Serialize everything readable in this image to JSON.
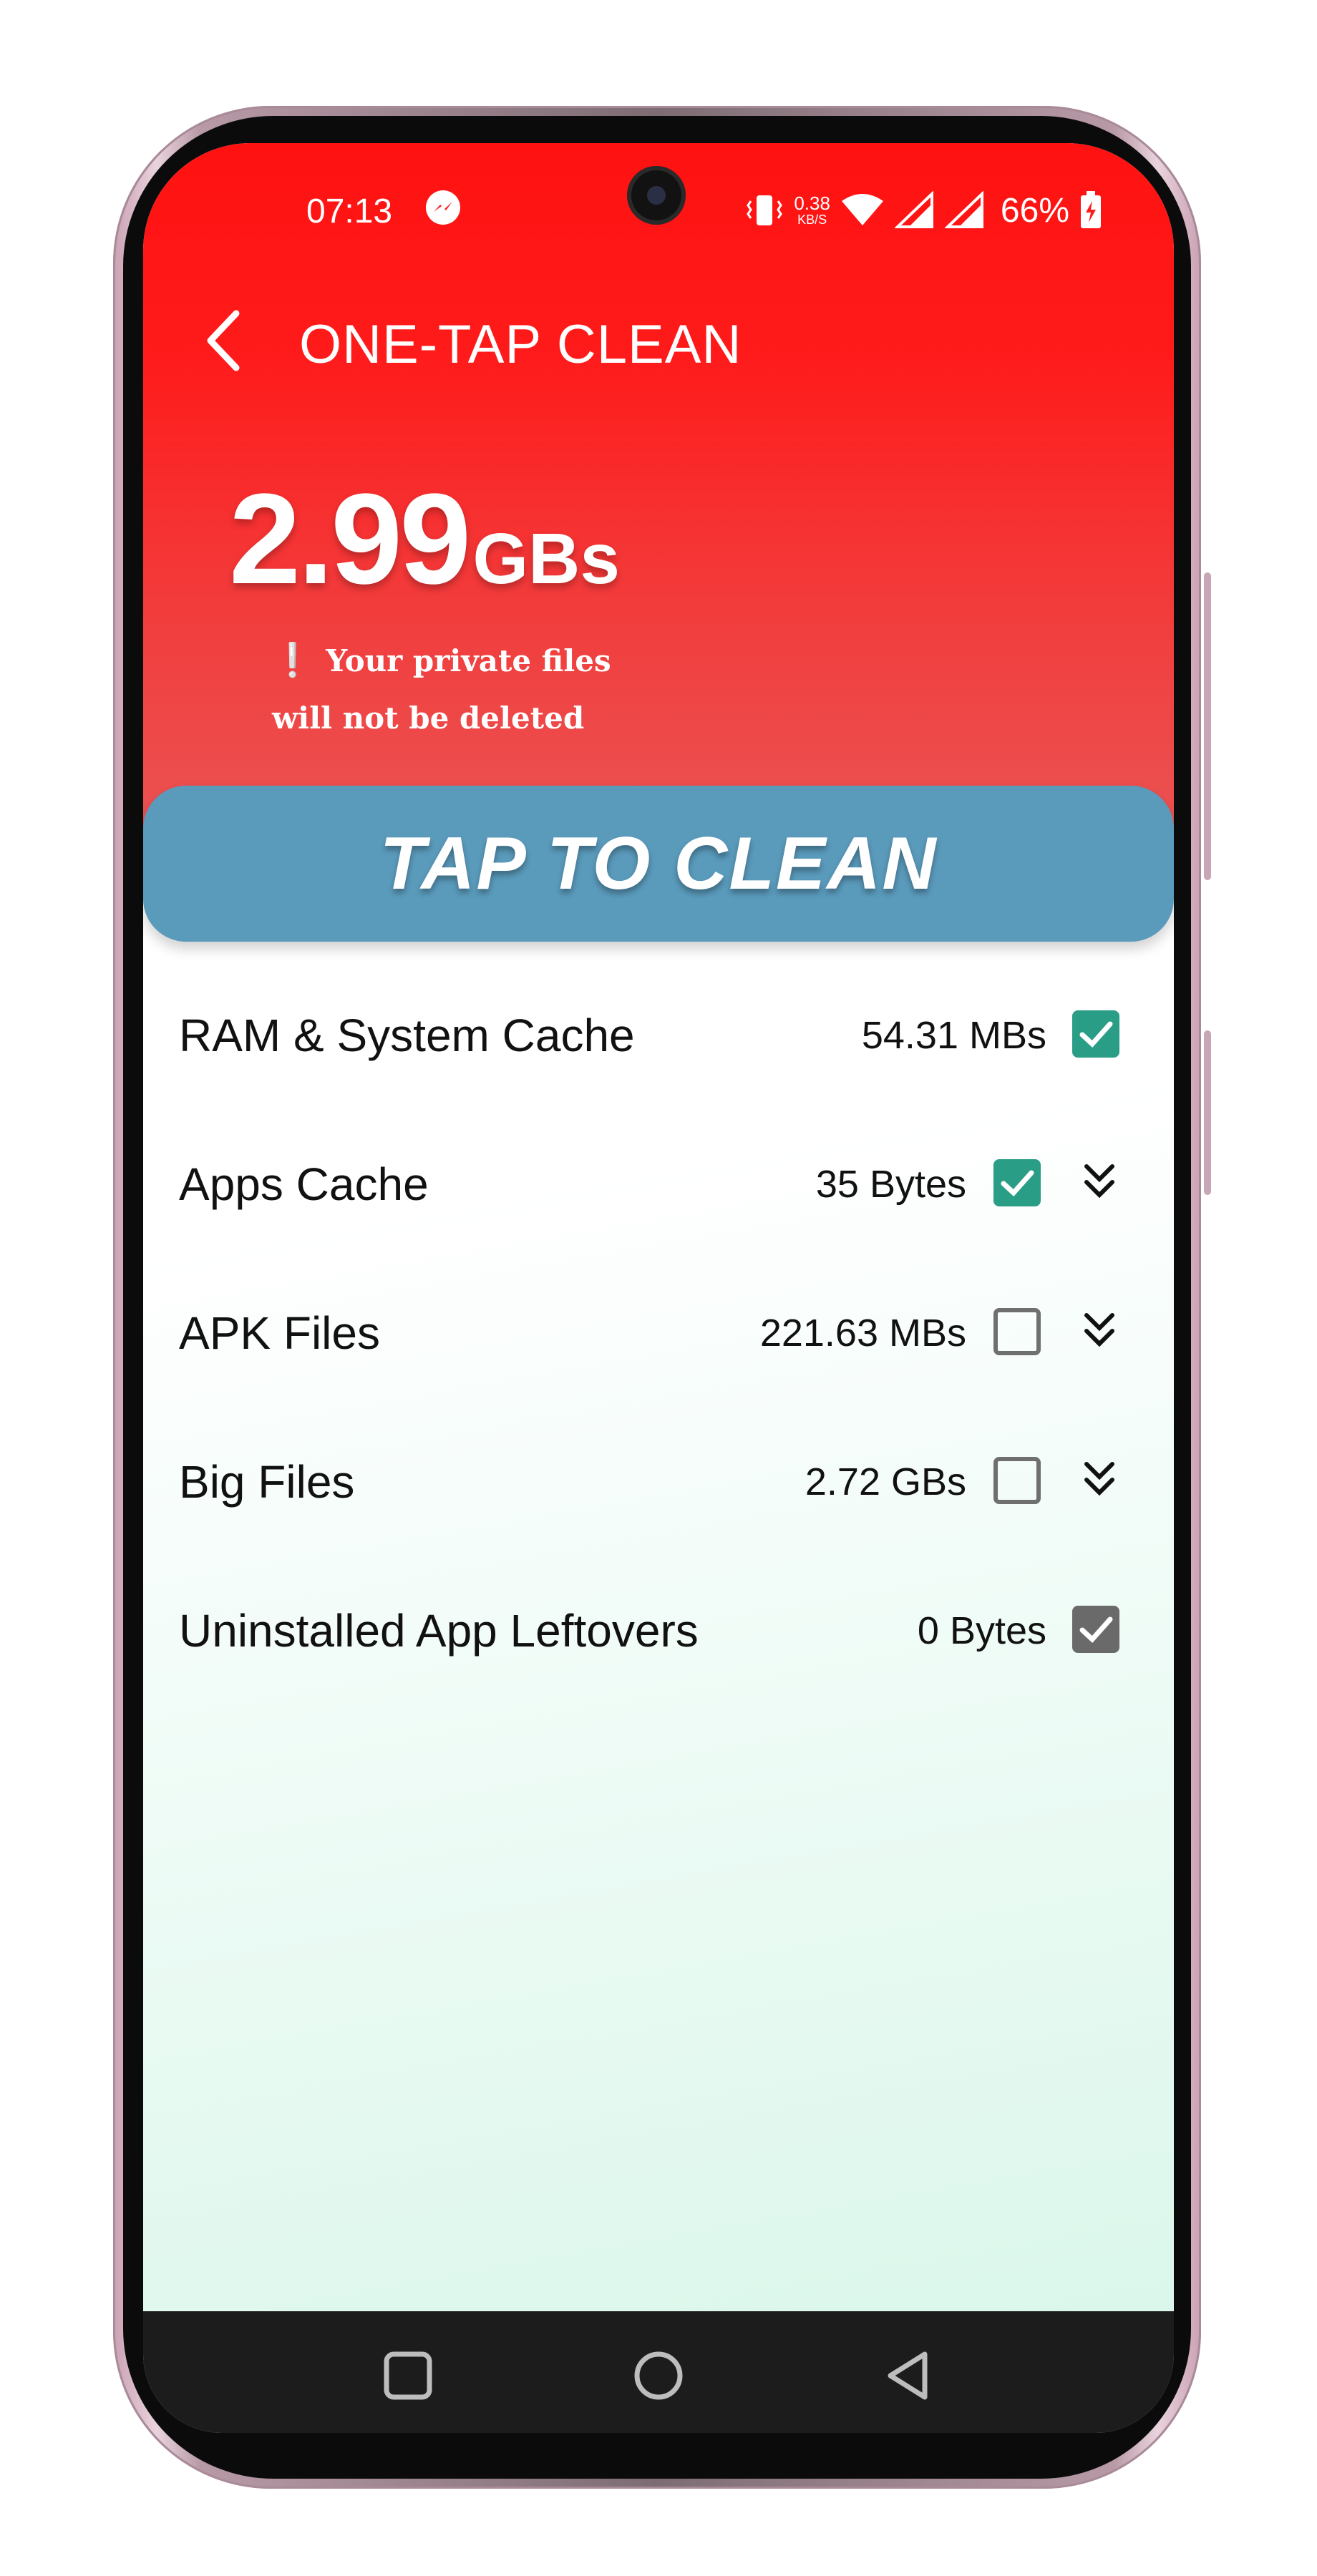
{
  "status": {
    "time": "07:13",
    "speed_value": "0.38",
    "speed_unit": "KB/S",
    "battery": "66%"
  },
  "header": {
    "title": "ONE-TAP CLEAN",
    "size_value": "2.99",
    "size_unit": "GBs",
    "notice_line1": "Your private files",
    "notice_line2": "will not be deleted"
  },
  "action": {
    "label": "TAP TO CLEAN"
  },
  "items": [
    {
      "label": "RAM & System Cache",
      "size": "54.31 MBs",
      "checked": true
    },
    {
      "label": "Apps Cache",
      "size": "35 Bytes",
      "checked": true
    },
    {
      "label": "APK Files",
      "size": "221.63 MBs",
      "checked": false
    },
    {
      "label": "Big Files",
      "size": "2.72 GBs",
      "checked": false
    },
    {
      "label": "Uninstalled App Leftovers",
      "size": "0 Bytes",
      "checked": true
    }
  ],
  "colors": {
    "header_red": "#ff1b1b",
    "button_blue": "#5a9abb",
    "check_green": "#2a9d87",
    "check_grey": "#6a6a6a"
  }
}
